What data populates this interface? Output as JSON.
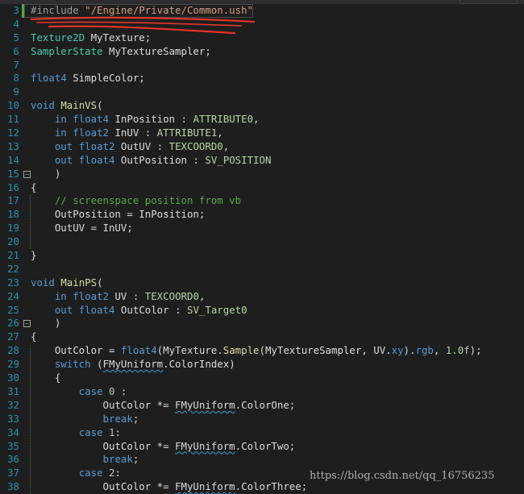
{
  "editor": {
    "language": "HLSL",
    "watermark": "https://blog.csdn.net/qq_16756235",
    "annotation_color": "#e8332a",
    "colors": {
      "background": "#1e1e1e",
      "line_number": "#2b91af",
      "keyword": "#569cd6",
      "type": "#4ec9b0",
      "function": "#dcdcaa",
      "semantic": "#b8d7a3",
      "string": "#d69d85",
      "comment": "#57a64a"
    }
  },
  "lines": [
    {
      "n": "3",
      "fold": null,
      "tokens": [
        [
          "prep",
          "#include "
        ],
        [
          "str",
          "\"/Engine/Private/Common.ush\""
        ]
      ]
    },
    {
      "n": "4",
      "fold": null,
      "tokens": []
    },
    {
      "n": "5",
      "fold": null,
      "tokens": [
        [
          "type",
          "Texture2D"
        ],
        [
          "plain",
          " MyTexture;"
        ]
      ]
    },
    {
      "n": "6",
      "fold": null,
      "tokens": [
        [
          "type",
          "SamplerState"
        ],
        [
          "plain",
          " MyTextureSampler;"
        ]
      ]
    },
    {
      "n": "7",
      "fold": null,
      "tokens": []
    },
    {
      "n": "8",
      "fold": null,
      "tokens": [
        [
          "kw",
          "float4"
        ],
        [
          "plain",
          " SimpleColor;"
        ]
      ]
    },
    {
      "n": "9",
      "fold": null,
      "tokens": []
    },
    {
      "n": "10",
      "fold": null,
      "tokens": [
        [
          "kw",
          "void"
        ],
        [
          "plain",
          " "
        ],
        [
          "fn",
          "MainVS"
        ],
        [
          "plain",
          "("
        ]
      ]
    },
    {
      "n": "11",
      "fold": null,
      "tokens": [
        [
          "plain",
          "    "
        ],
        [
          "kw",
          "in"
        ],
        [
          "plain",
          " "
        ],
        [
          "kw",
          "float4"
        ],
        [
          "plain",
          " InPosition : "
        ],
        [
          "sem",
          "ATTRIBUTE0"
        ],
        [
          "plain",
          ","
        ]
      ]
    },
    {
      "n": "12",
      "fold": null,
      "tokens": [
        [
          "plain",
          "    "
        ],
        [
          "kw",
          "in"
        ],
        [
          "plain",
          " "
        ],
        [
          "kw",
          "float2"
        ],
        [
          "plain",
          " InUV : "
        ],
        [
          "sem",
          "ATTRIBUTE1"
        ],
        [
          "plain",
          ","
        ]
      ]
    },
    {
      "n": "13",
      "fold": null,
      "tokens": [
        [
          "plain",
          "    "
        ],
        [
          "kw",
          "out"
        ],
        [
          "plain",
          " "
        ],
        [
          "kw",
          "float2"
        ],
        [
          "plain",
          " OutUV : "
        ],
        [
          "sem",
          "TEXCOORD0"
        ],
        [
          "plain",
          ","
        ]
      ]
    },
    {
      "n": "14",
      "fold": null,
      "tokens": [
        [
          "plain",
          "    "
        ],
        [
          "kw",
          "out"
        ],
        [
          "plain",
          " "
        ],
        [
          "kw",
          "float4"
        ],
        [
          "plain",
          " OutPosition : "
        ],
        [
          "sem",
          "SV_POSITION"
        ]
      ]
    },
    {
      "n": "15",
      "fold": "−",
      "tokens": [
        [
          "plain",
          "    )"
        ]
      ]
    },
    {
      "n": "16",
      "fold": null,
      "tokens": [
        [
          "plain",
          "{"
        ]
      ]
    },
    {
      "n": "17",
      "fold": null,
      "tokens": [
        [
          "plain",
          "    "
        ],
        [
          "cmt",
          "// screenspace position from vb"
        ]
      ]
    },
    {
      "n": "18",
      "fold": null,
      "tokens": [
        [
          "plain",
          "    OutPosition = InPosition;"
        ]
      ]
    },
    {
      "n": "19",
      "fold": null,
      "tokens": [
        [
          "plain",
          "    OutUV = InUV;"
        ]
      ]
    },
    {
      "n": "20",
      "fold": null,
      "tokens": []
    },
    {
      "n": "21",
      "fold": null,
      "tokens": [
        [
          "plain",
          "}"
        ]
      ]
    },
    {
      "n": "22",
      "fold": null,
      "tokens": []
    },
    {
      "n": "23",
      "fold": null,
      "tokens": [
        [
          "kw",
          "void"
        ],
        [
          "plain",
          " "
        ],
        [
          "fn",
          "MainPS"
        ],
        [
          "plain",
          "("
        ]
      ]
    },
    {
      "n": "24",
      "fold": null,
      "tokens": [
        [
          "plain",
          "    "
        ],
        [
          "kw",
          "in"
        ],
        [
          "plain",
          " "
        ],
        [
          "kw",
          "float2"
        ],
        [
          "plain",
          " UV : "
        ],
        [
          "sem",
          "TEXCOORD0"
        ],
        [
          "plain",
          ","
        ]
      ]
    },
    {
      "n": "25",
      "fold": null,
      "tokens": [
        [
          "plain",
          "    "
        ],
        [
          "kw",
          "out"
        ],
        [
          "plain",
          " "
        ],
        [
          "kw",
          "float4"
        ],
        [
          "plain",
          " OutColor : "
        ],
        [
          "sem",
          "SV_Target0"
        ]
      ]
    },
    {
      "n": "26",
      "fold": "−",
      "tokens": [
        [
          "plain",
          "    )"
        ]
      ]
    },
    {
      "n": "27",
      "fold": null,
      "tokens": [
        [
          "plain",
          "{"
        ]
      ]
    },
    {
      "n": "28",
      "fold": null,
      "tokens": [
        [
          "plain",
          "    OutColor = "
        ],
        [
          "kw",
          "float4"
        ],
        [
          "plain",
          "(MyTexture."
        ],
        [
          "fn",
          "Sample"
        ],
        [
          "plain",
          "(MyTextureSampler, UV."
        ],
        [
          "kw",
          "xy"
        ],
        [
          "plain",
          ")."
        ],
        [
          "kw",
          "rgb"
        ],
        [
          "plain",
          ", "
        ],
        [
          "num",
          "1.0f"
        ],
        [
          "plain",
          ");"
        ]
      ]
    },
    {
      "n": "29",
      "fold": null,
      "tokens": [
        [
          "plain",
          "    "
        ],
        [
          "kw",
          "switch"
        ],
        [
          "plain",
          " ("
        ],
        [
          "squig",
          "FMyUniform"
        ],
        [
          "plain",
          ".ColorIndex)"
        ]
      ]
    },
    {
      "n": "30",
      "fold": null,
      "tokens": [
        [
          "plain",
          "    {"
        ]
      ]
    },
    {
      "n": "31",
      "fold": null,
      "tokens": [
        [
          "plain",
          "        "
        ],
        [
          "kw",
          "case"
        ],
        [
          "plain",
          " "
        ],
        [
          "num",
          "0"
        ],
        [
          "plain",
          " :"
        ]
      ]
    },
    {
      "n": "32",
      "fold": null,
      "tokens": [
        [
          "plain",
          "            OutColor *= "
        ],
        [
          "squig",
          "FMyUniform"
        ],
        [
          "plain",
          ".ColorOne;"
        ]
      ]
    },
    {
      "n": "33",
      "fold": null,
      "tokens": [
        [
          "plain",
          "            "
        ],
        [
          "kw",
          "break"
        ],
        [
          "plain",
          ";"
        ]
      ]
    },
    {
      "n": "34",
      "fold": null,
      "tokens": [
        [
          "plain",
          "        "
        ],
        [
          "kw",
          "case"
        ],
        [
          "plain",
          " "
        ],
        [
          "num",
          "1"
        ],
        [
          "plain",
          ":"
        ]
      ]
    },
    {
      "n": "35",
      "fold": null,
      "tokens": [
        [
          "plain",
          "            OutColor *= "
        ],
        [
          "squig",
          "FMyUniform"
        ],
        [
          "plain",
          ".ColorTwo;"
        ]
      ]
    },
    {
      "n": "36",
      "fold": null,
      "tokens": [
        [
          "plain",
          "            "
        ],
        [
          "kw",
          "break"
        ],
        [
          "plain",
          ";"
        ]
      ]
    },
    {
      "n": "37",
      "fold": null,
      "tokens": [
        [
          "plain",
          "        "
        ],
        [
          "kw",
          "case"
        ],
        [
          "plain",
          " "
        ],
        [
          "num",
          "2"
        ],
        [
          "plain",
          ":"
        ]
      ]
    },
    {
      "n": "38",
      "fold": null,
      "tokens": [
        [
          "plain",
          "            OutColor *= "
        ],
        [
          "squig",
          "FMyUniform"
        ],
        [
          "plain",
          ".ColorThree;"
        ]
      ]
    }
  ]
}
